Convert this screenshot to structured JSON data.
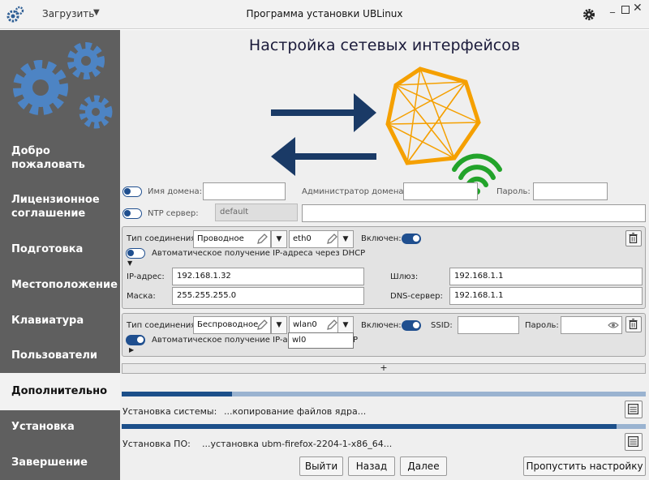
{
  "titlebar": {
    "load_label": "Загрузить",
    "title": "Программа установки UBLinux",
    "min_label": "_",
    "close_label": "✕",
    "icons": [
      "gears-app-icon",
      "gear-icon",
      "minimize-icon",
      "maximize-icon",
      "close-icon"
    ]
  },
  "sidebar": {
    "items": [
      {
        "label_line1": "Добро",
        "label_line2": "пожаловать"
      },
      {
        "label_line1": "Лицензионное",
        "label_line2": "соглашение"
      },
      {
        "label": "Подготовка"
      },
      {
        "label": "Местоположение"
      },
      {
        "label": "Клавиатура"
      },
      {
        "label": "Пользователи"
      },
      {
        "label": "Дополнительно",
        "active": true
      },
      {
        "label": "Установка"
      },
      {
        "label": "Завершение"
      }
    ]
  },
  "main": {
    "title": "Настройка сетевых интерфейсов",
    "domain": {
      "name_label": "Имя домена:",
      "name_value": "",
      "admin_label": "Администратор домена:",
      "admin_value": "",
      "password_label": "Пароль:",
      "password_value": ""
    },
    "ntp": {
      "label": "NTP сервер:",
      "mode": "default",
      "value": ""
    },
    "connections": [
      {
        "type_label": "Тип соединения:",
        "type_value": "Проводное",
        "iface_value": "eth0",
        "enabled_label": "Включен:",
        "enabled": true,
        "dhcp_label": "Автоматическое получение IP-адреса через DHCP",
        "dhcp": false,
        "ip_label": "IP-адрес:",
        "ip_value": "192.168.1.32",
        "gateway_label": "Шлюз:",
        "gateway_value": "192.168.1.1",
        "mask_label": "Маска:",
        "mask_value": "255.255.255.0",
        "dns_label": "DNS-сервер:",
        "dns_value": "192.168.1.1"
      },
      {
        "type_label": "Тип соединения:",
        "type_value": "Беспроводное",
        "iface_value": "wlan0",
        "enabled_label": "Включен:",
        "enabled": true,
        "ssid_label": "SSID:",
        "ssid_value": "",
        "password_label": "Пароль:",
        "password_value": "",
        "dhcp_label_visible": "Автоматическое получение IP-адр",
        "dhcp_label_tail": "P",
        "dhcp": true,
        "dropdown_options": [
          "wl0"
        ]
      }
    ],
    "add_label": "+",
    "install_status": {
      "label": "Установка системы:",
      "text": "...копирование файлов ядра...",
      "progress": 0.21
    },
    "software_status": {
      "label": "Установка ПО:",
      "text": "...установка ubm-firefox-2204-1-x86_64...",
      "progress": 0.945
    },
    "buttons": {
      "exit": "Выйти",
      "back": "Назад",
      "next": "Далее",
      "skip": "Пропустить настройку"
    }
  },
  "colors": {
    "sidebar_bg": "#5f5f5f",
    "accent": "#1c4f8a",
    "hexagon": "#f5a000",
    "wifi": "#22a32a",
    "arrow": "#1a3a66"
  }
}
